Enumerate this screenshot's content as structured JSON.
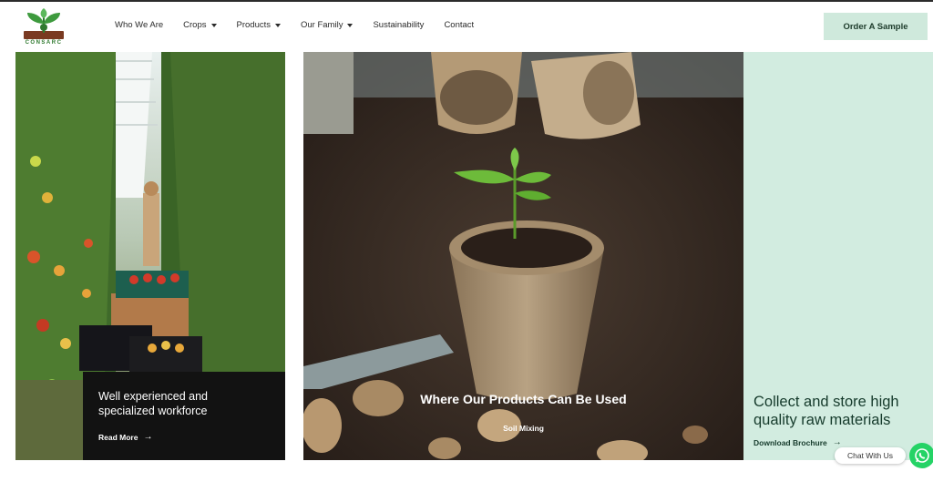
{
  "brand": {
    "name": "CONSARC",
    "logo_icon": "leaf-logo-icon"
  },
  "nav": {
    "items": [
      {
        "label": "Who We Are",
        "dropdown": false
      },
      {
        "label": "Crops",
        "dropdown": true
      },
      {
        "label": "Products",
        "dropdown": true
      },
      {
        "label": "Our Family",
        "dropdown": true
      },
      {
        "label": "Sustainability",
        "dropdown": false
      },
      {
        "label": "Contact",
        "dropdown": false
      }
    ],
    "cta_label": "Order A Sample"
  },
  "panels": {
    "left": {
      "title": "Well experienced and specialized workforce",
      "link_label": "Read More",
      "image": "greenhouse-tomatoes-image"
    },
    "middle": {
      "title": "Where Our Products Can Be Used",
      "subtitle": "Soil Mixing",
      "image": "seedling-peat-pot-image"
    },
    "right": {
      "title": "Collect and store high quality raw materials",
      "link_label": "Download Brochure"
    }
  },
  "chat": {
    "label": "Chat With Us",
    "icon": "whatsapp-icon"
  },
  "colors": {
    "accent_mint": "#cfe9dc",
    "dark_green": "#163b2c",
    "card_black": "#121212",
    "whatsapp": "#25d366"
  }
}
